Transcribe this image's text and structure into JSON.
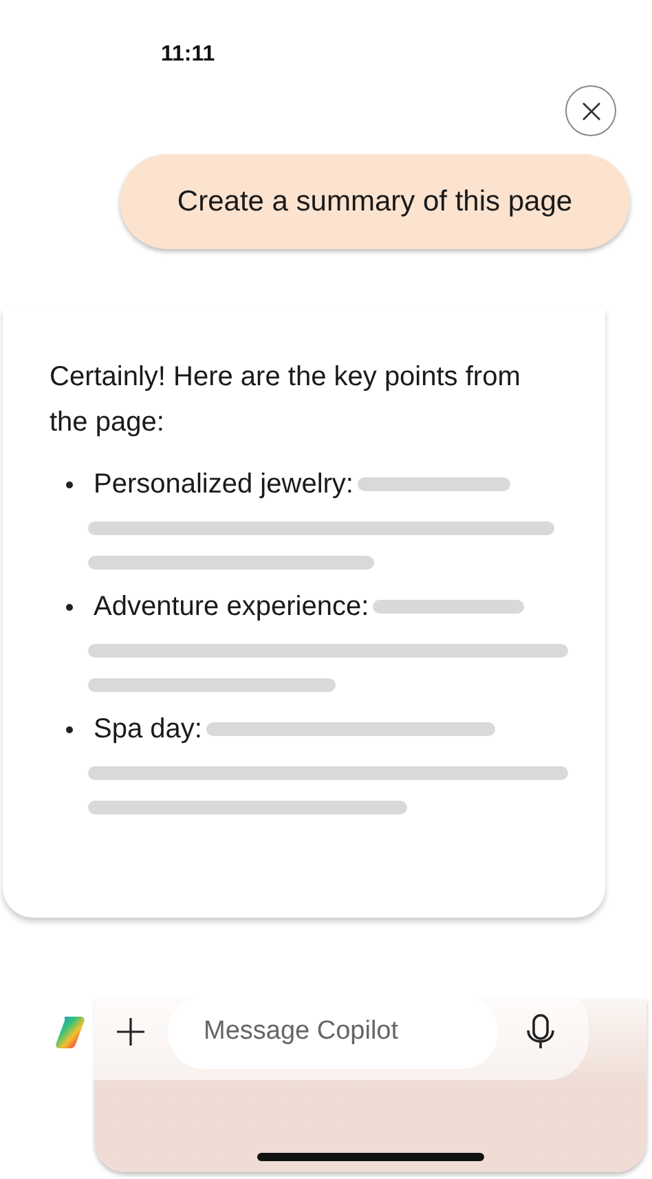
{
  "status_bar": {
    "time": "11:11"
  },
  "user_message": {
    "text": "Create a summary of this page"
  },
  "response": {
    "intro": "Certainly! Here are the key points from the page:",
    "points": [
      {
        "label": "Personalized jewelry:"
      },
      {
        "label": "Adventure experience:"
      },
      {
        "label": "Spa day:"
      }
    ]
  },
  "composer": {
    "placeholder": "Message Copilot"
  }
}
